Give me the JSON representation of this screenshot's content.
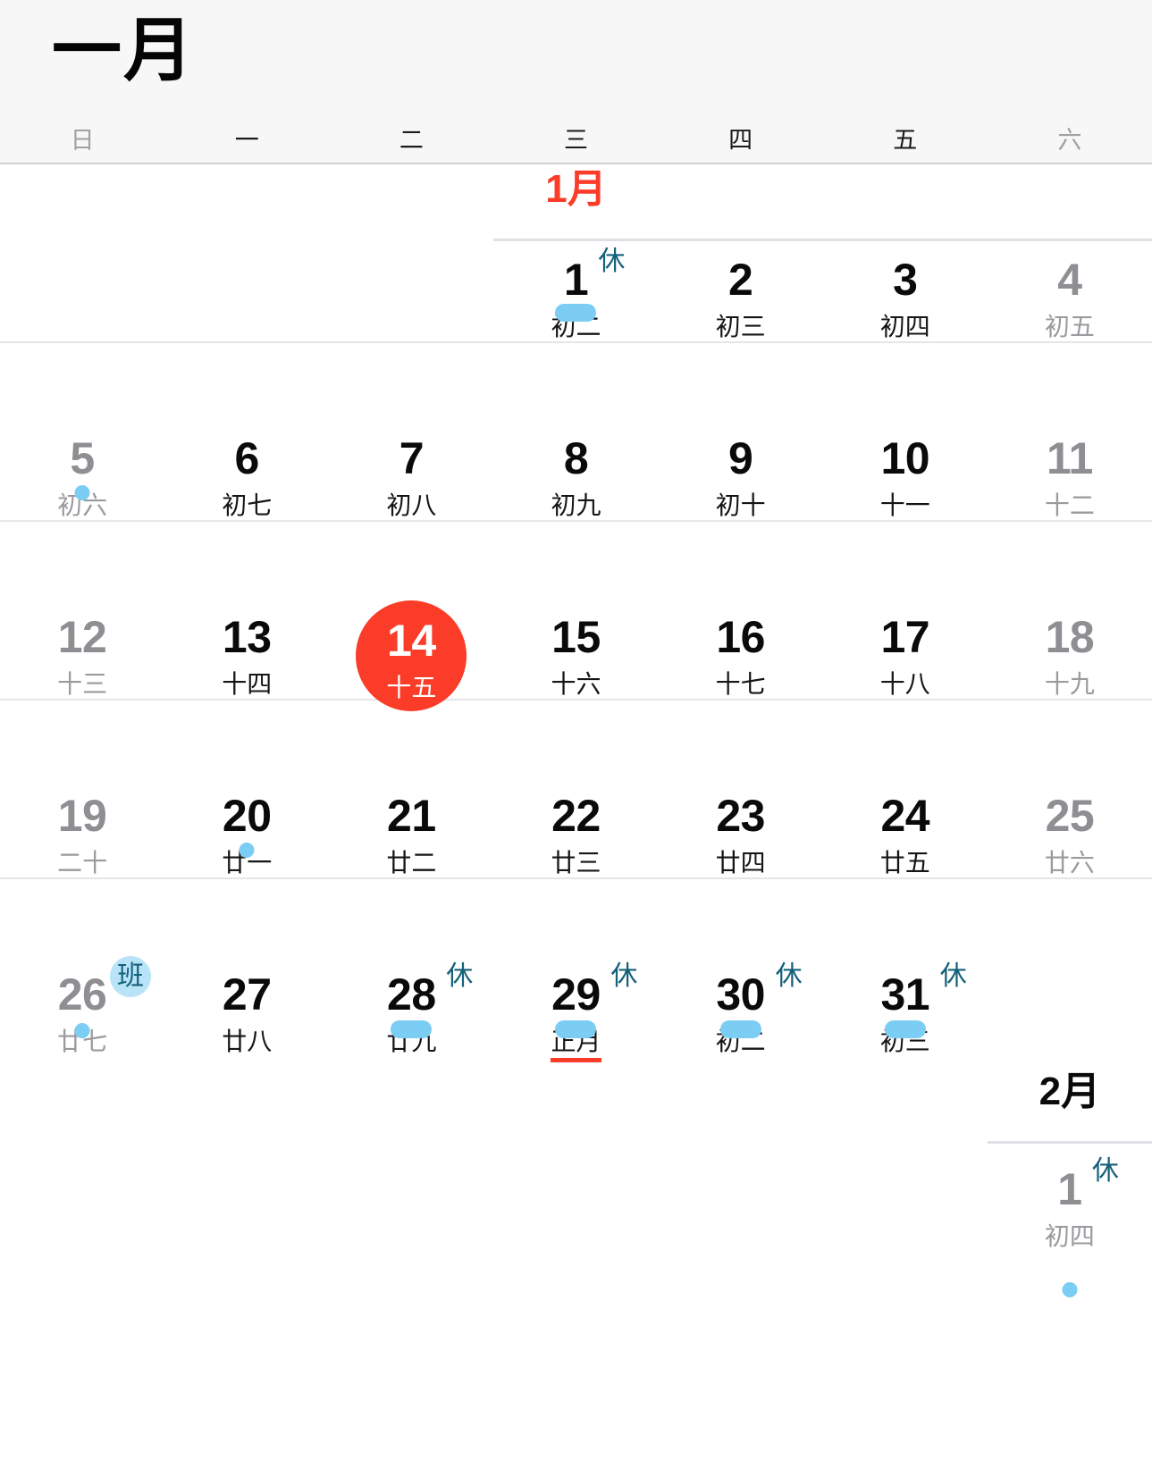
{
  "header": {
    "month_title": "一月"
  },
  "weekdays": [
    {
      "label": "日",
      "weekend": true
    },
    {
      "label": "一",
      "weekend": false
    },
    {
      "label": "二",
      "weekend": false
    },
    {
      "label": "三",
      "weekend": false
    },
    {
      "label": "四",
      "weekend": false
    },
    {
      "label": "五",
      "weekend": false
    },
    {
      "label": "六",
      "weekend": true
    }
  ],
  "colors": {
    "today_red": "#fa3c28",
    "month_start_red": "#fa3c28",
    "badge_blue": "#15607a",
    "badge_work_bg": "#b9e3f7",
    "event_blue": "#7ccdf3",
    "dim_gray": "#8e8e93",
    "header_bg": "#f7f7f7"
  },
  "month_markers": {
    "january": {
      "label": "1月",
      "color": "#fa3c28"
    },
    "february": {
      "label": "2月",
      "color": "#0a0a0a"
    }
  },
  "weeks": [
    {
      "name": "week-1",
      "days": [
        {
          "empty": true
        },
        {
          "empty": true
        },
        {
          "empty": true
        },
        {
          "day": "1",
          "lunar": "初二",
          "dim": false,
          "badge": "休",
          "badge_type": "rest",
          "indicator": "pill",
          "month_start": "1月"
        },
        {
          "day": "2",
          "lunar": "初三",
          "dim": false,
          "badge": "",
          "badge_type": "",
          "indicator": "none"
        },
        {
          "day": "3",
          "lunar": "初四",
          "dim": false,
          "badge": "",
          "badge_type": "",
          "indicator": "none"
        },
        {
          "day": "4",
          "lunar": "初五",
          "dim": true,
          "badge": "",
          "badge_type": "",
          "indicator": "none"
        }
      ]
    },
    {
      "name": "week-2",
      "days": [
        {
          "day": "5",
          "lunar": "初六",
          "dim": true,
          "badge": "",
          "badge_type": "",
          "indicator": "dot"
        },
        {
          "day": "6",
          "lunar": "初七",
          "dim": false,
          "badge": "",
          "badge_type": "",
          "indicator": "none"
        },
        {
          "day": "7",
          "lunar": "初八",
          "dim": false,
          "badge": "",
          "badge_type": "",
          "indicator": "none"
        },
        {
          "day": "8",
          "lunar": "初九",
          "dim": false,
          "badge": "",
          "badge_type": "",
          "indicator": "none"
        },
        {
          "day": "9",
          "lunar": "初十",
          "dim": false,
          "badge": "",
          "badge_type": "",
          "indicator": "none"
        },
        {
          "day": "10",
          "lunar": "十一",
          "dim": false,
          "badge": "",
          "badge_type": "",
          "indicator": "none"
        },
        {
          "day": "11",
          "lunar": "十二",
          "dim": true,
          "badge": "",
          "badge_type": "",
          "indicator": "none"
        }
      ]
    },
    {
      "name": "week-3",
      "days": [
        {
          "day": "12",
          "lunar": "十三",
          "dim": true,
          "badge": "",
          "badge_type": "",
          "indicator": "none"
        },
        {
          "day": "13",
          "lunar": "十四",
          "dim": false,
          "badge": "",
          "badge_type": "",
          "indicator": "none"
        },
        {
          "day": "14",
          "lunar": "十五",
          "dim": false,
          "badge": "",
          "badge_type": "",
          "indicator": "none",
          "today": true
        },
        {
          "day": "15",
          "lunar": "十六",
          "dim": false,
          "badge": "",
          "badge_type": "",
          "indicator": "none"
        },
        {
          "day": "16",
          "lunar": "十七",
          "dim": false,
          "badge": "",
          "badge_type": "",
          "indicator": "none"
        },
        {
          "day": "17",
          "lunar": "十八",
          "dim": false,
          "badge": "",
          "badge_type": "",
          "indicator": "none"
        },
        {
          "day": "18",
          "lunar": "十九",
          "dim": true,
          "badge": "",
          "badge_type": "",
          "indicator": "none"
        }
      ]
    },
    {
      "name": "week-4",
      "days": [
        {
          "day": "19",
          "lunar": "二十",
          "dim": true,
          "badge": "",
          "badge_type": "",
          "indicator": "none"
        },
        {
          "day": "20",
          "lunar": "廿一",
          "dim": false,
          "badge": "",
          "badge_type": "",
          "indicator": "dot"
        },
        {
          "day": "21",
          "lunar": "廿二",
          "dim": false,
          "badge": "",
          "badge_type": "",
          "indicator": "none"
        },
        {
          "day": "22",
          "lunar": "廿三",
          "dim": false,
          "badge": "",
          "badge_type": "",
          "indicator": "none"
        },
        {
          "day": "23",
          "lunar": "廿四",
          "dim": false,
          "badge": "",
          "badge_type": "",
          "indicator": "none"
        },
        {
          "day": "24",
          "lunar": "廿五",
          "dim": false,
          "badge": "",
          "badge_type": "",
          "indicator": "none"
        },
        {
          "day": "25",
          "lunar": "廿六",
          "dim": true,
          "badge": "",
          "badge_type": "",
          "indicator": "none"
        }
      ]
    },
    {
      "name": "week-5",
      "days": [
        {
          "day": "26",
          "lunar": "廿七",
          "dim": true,
          "badge": "班",
          "badge_type": "work",
          "indicator": "dot"
        },
        {
          "day": "27",
          "lunar": "廿八",
          "dim": false,
          "badge": "",
          "badge_type": "",
          "indicator": "none"
        },
        {
          "day": "28",
          "lunar": "廿九",
          "dim": false,
          "badge": "休",
          "badge_type": "rest",
          "indicator": "pill"
        },
        {
          "day": "29",
          "lunar": "正月",
          "dim": false,
          "badge": "休",
          "badge_type": "rest",
          "indicator": "pill",
          "lunar_underline": true
        },
        {
          "day": "30",
          "lunar": "初二",
          "dim": false,
          "badge": "休",
          "badge_type": "rest",
          "indicator": "pill"
        },
        {
          "day": "31",
          "lunar": "初三",
          "dim": false,
          "badge": "休",
          "badge_type": "rest",
          "indicator": "pill"
        },
        {
          "empty": true
        }
      ]
    },
    {
      "name": "week-6",
      "tail": true,
      "days": [
        {
          "empty": true
        },
        {
          "empty": true
        },
        {
          "empty": true
        },
        {
          "empty": true
        },
        {
          "empty": true
        },
        {
          "empty": true
        },
        {
          "day": "1",
          "lunar": "初四",
          "dim": true,
          "badge": "休",
          "badge_type": "rest",
          "indicator": "dot",
          "month_start": "2月"
        }
      ]
    }
  ]
}
